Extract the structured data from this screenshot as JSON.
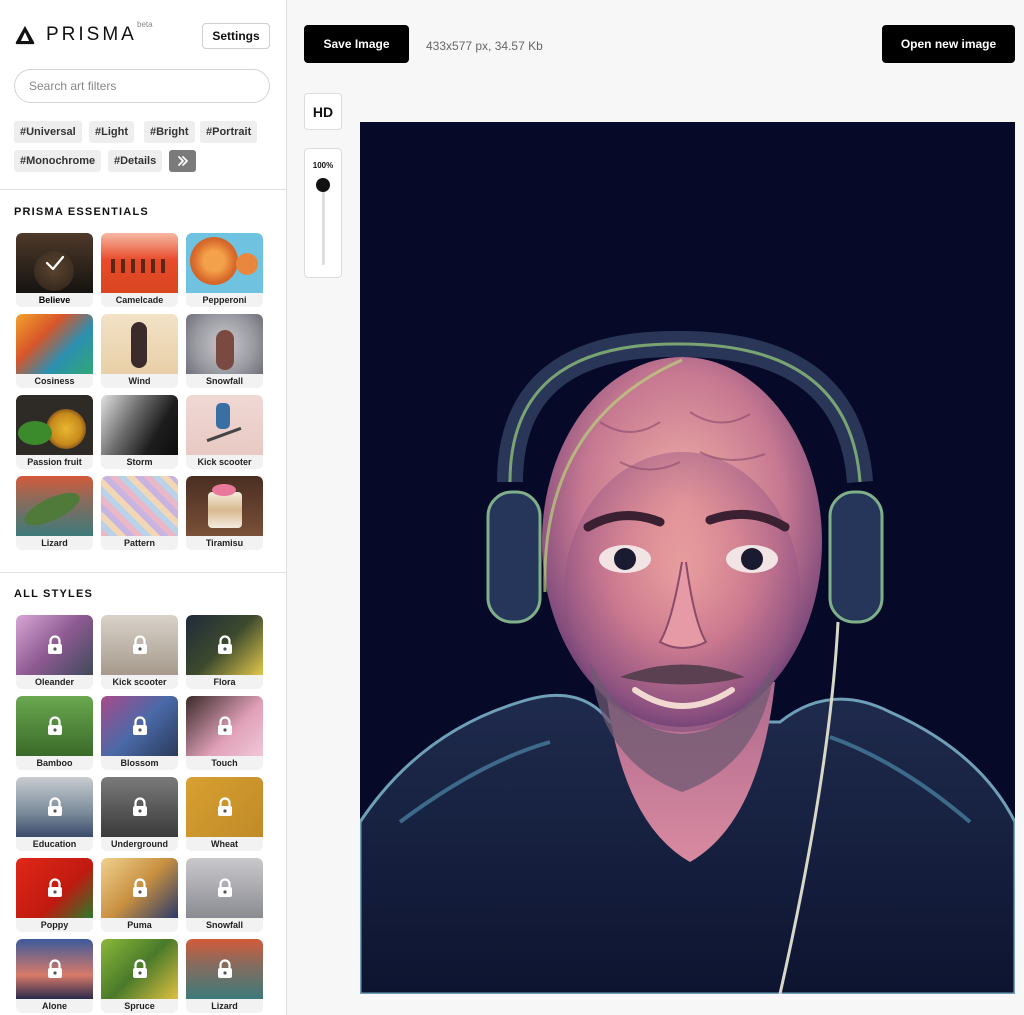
{
  "app": {
    "name": "PRISMA",
    "badge": "beta",
    "settings_label": "Settings"
  },
  "search": {
    "placeholder": "Search art filters",
    "value": ""
  },
  "tags": [
    "#Universal",
    "#Light",
    "#Bright",
    "#Portrait",
    "#Monochrome",
    "#Details"
  ],
  "tags_more_icon": "chevron-double-right-icon",
  "essentials": {
    "title": "PRISMA ESSENTIALS",
    "items": [
      {
        "label": "Believe",
        "selected": true
      },
      {
        "label": "Camelcade"
      },
      {
        "label": "Pepperoni"
      },
      {
        "label": "Cosiness"
      },
      {
        "label": "Wind"
      },
      {
        "label": "Snowfall"
      },
      {
        "label": "Passion fruit"
      },
      {
        "label": "Storm"
      },
      {
        "label": "Kick scooter"
      },
      {
        "label": "Lizard"
      },
      {
        "label": "Pattern"
      },
      {
        "label": "Tiramisu"
      }
    ]
  },
  "all_styles": {
    "title": "ALL STYLES",
    "items": [
      {
        "label": "Oleander",
        "locked": true
      },
      {
        "label": "Kick scooter",
        "locked": true
      },
      {
        "label": "Flora",
        "locked": true
      },
      {
        "label": "Bamboo",
        "locked": true
      },
      {
        "label": "Blossom",
        "locked": true
      },
      {
        "label": "Touch",
        "locked": true
      },
      {
        "label": "Education",
        "locked": true
      },
      {
        "label": "Underground",
        "locked": true
      },
      {
        "label": "Wheat",
        "locked": true
      },
      {
        "label": "Poppy",
        "locked": true
      },
      {
        "label": "Puma",
        "locked": true
      },
      {
        "label": "Snowfall",
        "locked": true
      },
      {
        "label": "Alone",
        "locked": true
      },
      {
        "label": "Spruce",
        "locked": true
      },
      {
        "label": "Lizard",
        "locked": true
      }
    ]
  },
  "toolbar": {
    "save_label": "Save Image",
    "image_info": "433x577 px, 34.57 Kb",
    "open_label": "Open new image"
  },
  "hd_label": "HD",
  "zoom": {
    "label": "100%",
    "value_percent": 100
  },
  "colors": {
    "accent": "#000000",
    "canvas_bg": "#060a28"
  }
}
